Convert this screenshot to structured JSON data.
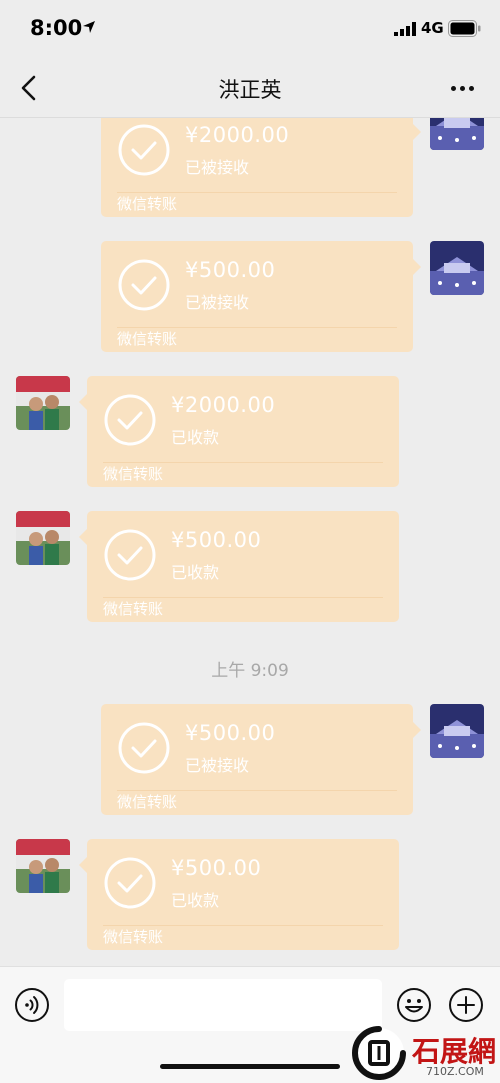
{
  "status_bar": {
    "time": "8:00",
    "network": "4G"
  },
  "nav": {
    "title": "洪正英"
  },
  "messages": [
    {
      "side": "right",
      "amount": "¥2000.00",
      "status": "已被接收",
      "label": "微信转账"
    },
    {
      "side": "right",
      "amount": "¥500.00",
      "status": "已被接收",
      "label": "微信转账"
    },
    {
      "side": "left",
      "amount": "¥2000.00",
      "status": "已收款",
      "label": "微信转账"
    },
    {
      "side": "left",
      "amount": "¥500.00",
      "status": "已收款",
      "label": "微信转账"
    },
    {
      "side": "right",
      "amount": "¥500.00",
      "status": "已被接收",
      "label": "微信转账"
    },
    {
      "side": "left",
      "amount": "¥500.00",
      "status": "已收款",
      "label": "微信转账"
    }
  ],
  "timestamp": "上午 9:09",
  "input": {
    "value": "",
    "placeholder": ""
  },
  "watermark": {
    "text": "石展網",
    "sub": "710Z.COM"
  },
  "colors": {
    "bubble": "#f9e2c2",
    "background": "#ededed",
    "watermark": "#c21515"
  }
}
